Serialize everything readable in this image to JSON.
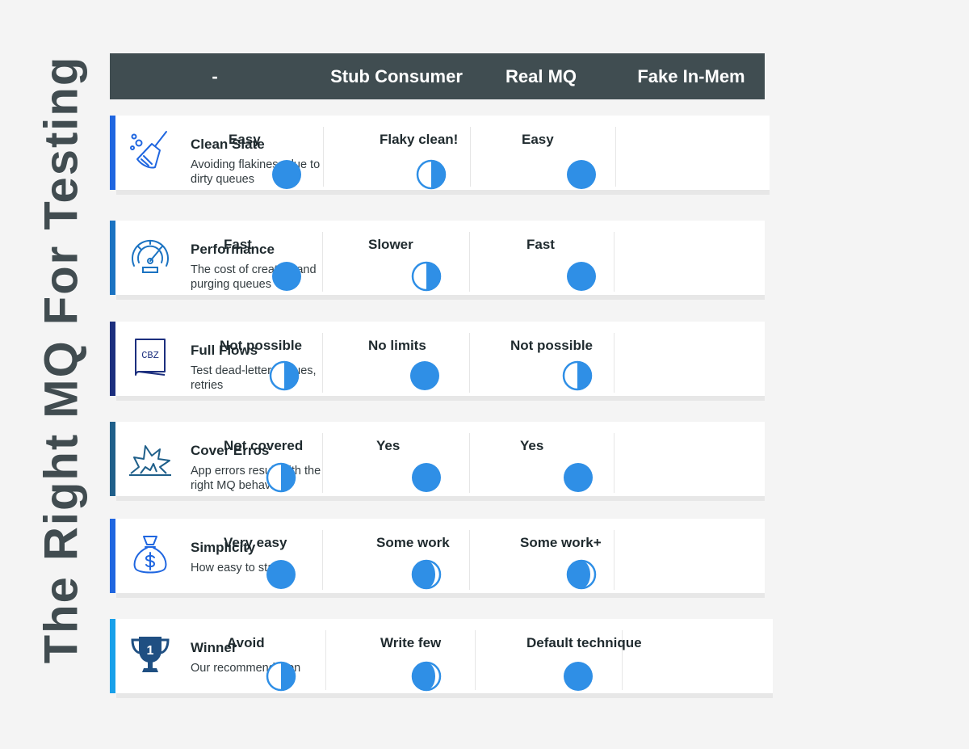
{
  "title": "The Right MQ For Testing",
  "colors": {
    "ball": "#2f8fe6",
    "header_bg": "#404d51"
  },
  "header": {
    "label_col": "-",
    "col1": "Stub Consumer",
    "col2": "Real MQ",
    "col3": "Fake In-Mem"
  },
  "rows": [
    {
      "title": "Clean Slate",
      "subtitle": "Avoiding flakiness due to dirty queues",
      "icon": "broom-icon",
      "accent": "#1f66e0",
      "cells": [
        {
          "text": "Easy",
          "rating": "full"
        },
        {
          "text": "Flaky clean!",
          "rating": "half"
        },
        {
          "text": "Easy",
          "rating": "full"
        }
      ]
    },
    {
      "title": "Performance",
      "subtitle": "The cost of creating and purging queues",
      "icon": "speedometer-icon",
      "accent": "#1b73c2",
      "cells": [
        {
          "text": "Fast",
          "rating": "full"
        },
        {
          "text": "Slower",
          "rating": "half"
        },
        {
          "text": "Fast",
          "rating": "full"
        }
      ]
    },
    {
      "title": "Full Flows",
      "subtitle": "Test dead-letter queues, retries",
      "icon": "book-icon",
      "icon_text": "CBZ",
      "accent": "#1c2f7e",
      "cells": [
        {
          "text": "Not possible",
          "rating": "half"
        },
        {
          "text": "No limits",
          "rating": "full"
        },
        {
          "text": "Not possible",
          "rating": "half"
        }
      ]
    },
    {
      "title": "Cover Erros",
      "subtitle": "App errors result with the right MQ behaviour",
      "icon": "explosion-icon",
      "accent": "#1f5f8a",
      "cells": [
        {
          "text": "Not covered",
          "rating": "half"
        },
        {
          "text": "Yes",
          "rating": "full"
        },
        {
          "text": "Yes",
          "rating": "full"
        }
      ]
    },
    {
      "title": "Simplicity",
      "subtitle": "How easy to start",
      "icon": "money-bag-icon",
      "accent": "#1f66e0",
      "cells": [
        {
          "text": "Very easy",
          "rating": "full"
        },
        {
          "text": "Some work",
          "rating": "three-quarter"
        },
        {
          "text": "Some work+",
          "rating": "three-quarter"
        }
      ]
    },
    {
      "title": "Winner",
      "subtitle": "Our recommendation",
      "icon": "trophy-icon",
      "icon_text": "1",
      "accent": "#18a0ea",
      "cells": [
        {
          "text": "Avoid",
          "rating": "half"
        },
        {
          "text": "Write few",
          "rating": "three-quarter"
        },
        {
          "text": "Default technique",
          "rating": "full"
        }
      ]
    }
  ]
}
